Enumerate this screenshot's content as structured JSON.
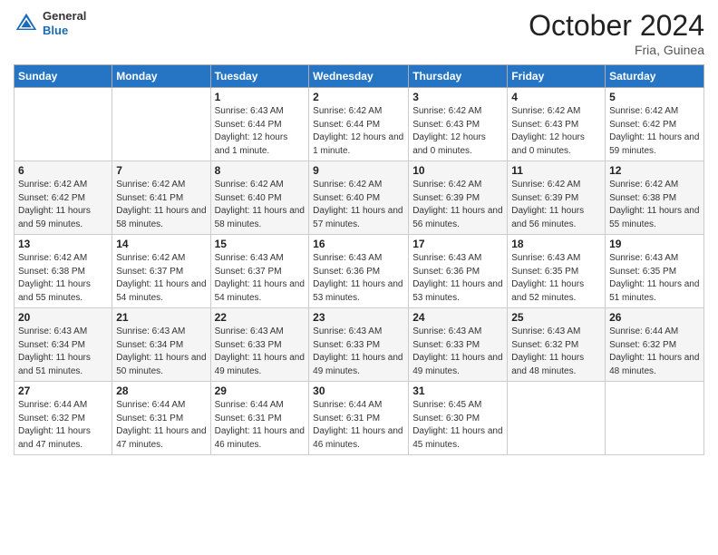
{
  "logo": {
    "general": "General",
    "blue": "Blue"
  },
  "title": "October 2024",
  "location": "Fria, Guinea",
  "days_of_week": [
    "Sunday",
    "Monday",
    "Tuesday",
    "Wednesday",
    "Thursday",
    "Friday",
    "Saturday"
  ],
  "weeks": [
    [
      {
        "day": "",
        "info": ""
      },
      {
        "day": "",
        "info": ""
      },
      {
        "day": "1",
        "info": "Sunrise: 6:43 AM\nSunset: 6:44 PM\nDaylight: 12 hours and 1 minute."
      },
      {
        "day": "2",
        "info": "Sunrise: 6:42 AM\nSunset: 6:44 PM\nDaylight: 12 hours and 1 minute."
      },
      {
        "day": "3",
        "info": "Sunrise: 6:42 AM\nSunset: 6:43 PM\nDaylight: 12 hours and 0 minutes."
      },
      {
        "day": "4",
        "info": "Sunrise: 6:42 AM\nSunset: 6:43 PM\nDaylight: 12 hours and 0 minutes."
      },
      {
        "day": "5",
        "info": "Sunrise: 6:42 AM\nSunset: 6:42 PM\nDaylight: 11 hours and 59 minutes."
      }
    ],
    [
      {
        "day": "6",
        "info": "Sunrise: 6:42 AM\nSunset: 6:42 PM\nDaylight: 11 hours and 59 minutes."
      },
      {
        "day": "7",
        "info": "Sunrise: 6:42 AM\nSunset: 6:41 PM\nDaylight: 11 hours and 58 minutes."
      },
      {
        "day": "8",
        "info": "Sunrise: 6:42 AM\nSunset: 6:40 PM\nDaylight: 11 hours and 58 minutes."
      },
      {
        "day": "9",
        "info": "Sunrise: 6:42 AM\nSunset: 6:40 PM\nDaylight: 11 hours and 57 minutes."
      },
      {
        "day": "10",
        "info": "Sunrise: 6:42 AM\nSunset: 6:39 PM\nDaylight: 11 hours and 56 minutes."
      },
      {
        "day": "11",
        "info": "Sunrise: 6:42 AM\nSunset: 6:39 PM\nDaylight: 11 hours and 56 minutes."
      },
      {
        "day": "12",
        "info": "Sunrise: 6:42 AM\nSunset: 6:38 PM\nDaylight: 11 hours and 55 minutes."
      }
    ],
    [
      {
        "day": "13",
        "info": "Sunrise: 6:42 AM\nSunset: 6:38 PM\nDaylight: 11 hours and 55 minutes."
      },
      {
        "day": "14",
        "info": "Sunrise: 6:42 AM\nSunset: 6:37 PM\nDaylight: 11 hours and 54 minutes."
      },
      {
        "day": "15",
        "info": "Sunrise: 6:43 AM\nSunset: 6:37 PM\nDaylight: 11 hours and 54 minutes."
      },
      {
        "day": "16",
        "info": "Sunrise: 6:43 AM\nSunset: 6:36 PM\nDaylight: 11 hours and 53 minutes."
      },
      {
        "day": "17",
        "info": "Sunrise: 6:43 AM\nSunset: 6:36 PM\nDaylight: 11 hours and 53 minutes."
      },
      {
        "day": "18",
        "info": "Sunrise: 6:43 AM\nSunset: 6:35 PM\nDaylight: 11 hours and 52 minutes."
      },
      {
        "day": "19",
        "info": "Sunrise: 6:43 AM\nSunset: 6:35 PM\nDaylight: 11 hours and 51 minutes."
      }
    ],
    [
      {
        "day": "20",
        "info": "Sunrise: 6:43 AM\nSunset: 6:34 PM\nDaylight: 11 hours and 51 minutes."
      },
      {
        "day": "21",
        "info": "Sunrise: 6:43 AM\nSunset: 6:34 PM\nDaylight: 11 hours and 50 minutes."
      },
      {
        "day": "22",
        "info": "Sunrise: 6:43 AM\nSunset: 6:33 PM\nDaylight: 11 hours and 49 minutes."
      },
      {
        "day": "23",
        "info": "Sunrise: 6:43 AM\nSunset: 6:33 PM\nDaylight: 11 hours and 49 minutes."
      },
      {
        "day": "24",
        "info": "Sunrise: 6:43 AM\nSunset: 6:33 PM\nDaylight: 11 hours and 49 minutes."
      },
      {
        "day": "25",
        "info": "Sunrise: 6:43 AM\nSunset: 6:32 PM\nDaylight: 11 hours and 48 minutes."
      },
      {
        "day": "26",
        "info": "Sunrise: 6:44 AM\nSunset: 6:32 PM\nDaylight: 11 hours and 48 minutes."
      }
    ],
    [
      {
        "day": "27",
        "info": "Sunrise: 6:44 AM\nSunset: 6:32 PM\nDaylight: 11 hours and 47 minutes."
      },
      {
        "day": "28",
        "info": "Sunrise: 6:44 AM\nSunset: 6:31 PM\nDaylight: 11 hours and 47 minutes."
      },
      {
        "day": "29",
        "info": "Sunrise: 6:44 AM\nSunset: 6:31 PM\nDaylight: 11 hours and 46 minutes."
      },
      {
        "day": "30",
        "info": "Sunrise: 6:44 AM\nSunset: 6:31 PM\nDaylight: 11 hours and 46 minutes."
      },
      {
        "day": "31",
        "info": "Sunrise: 6:45 AM\nSunset: 6:30 PM\nDaylight: 11 hours and 45 minutes."
      },
      {
        "day": "",
        "info": ""
      },
      {
        "day": "",
        "info": ""
      }
    ]
  ]
}
